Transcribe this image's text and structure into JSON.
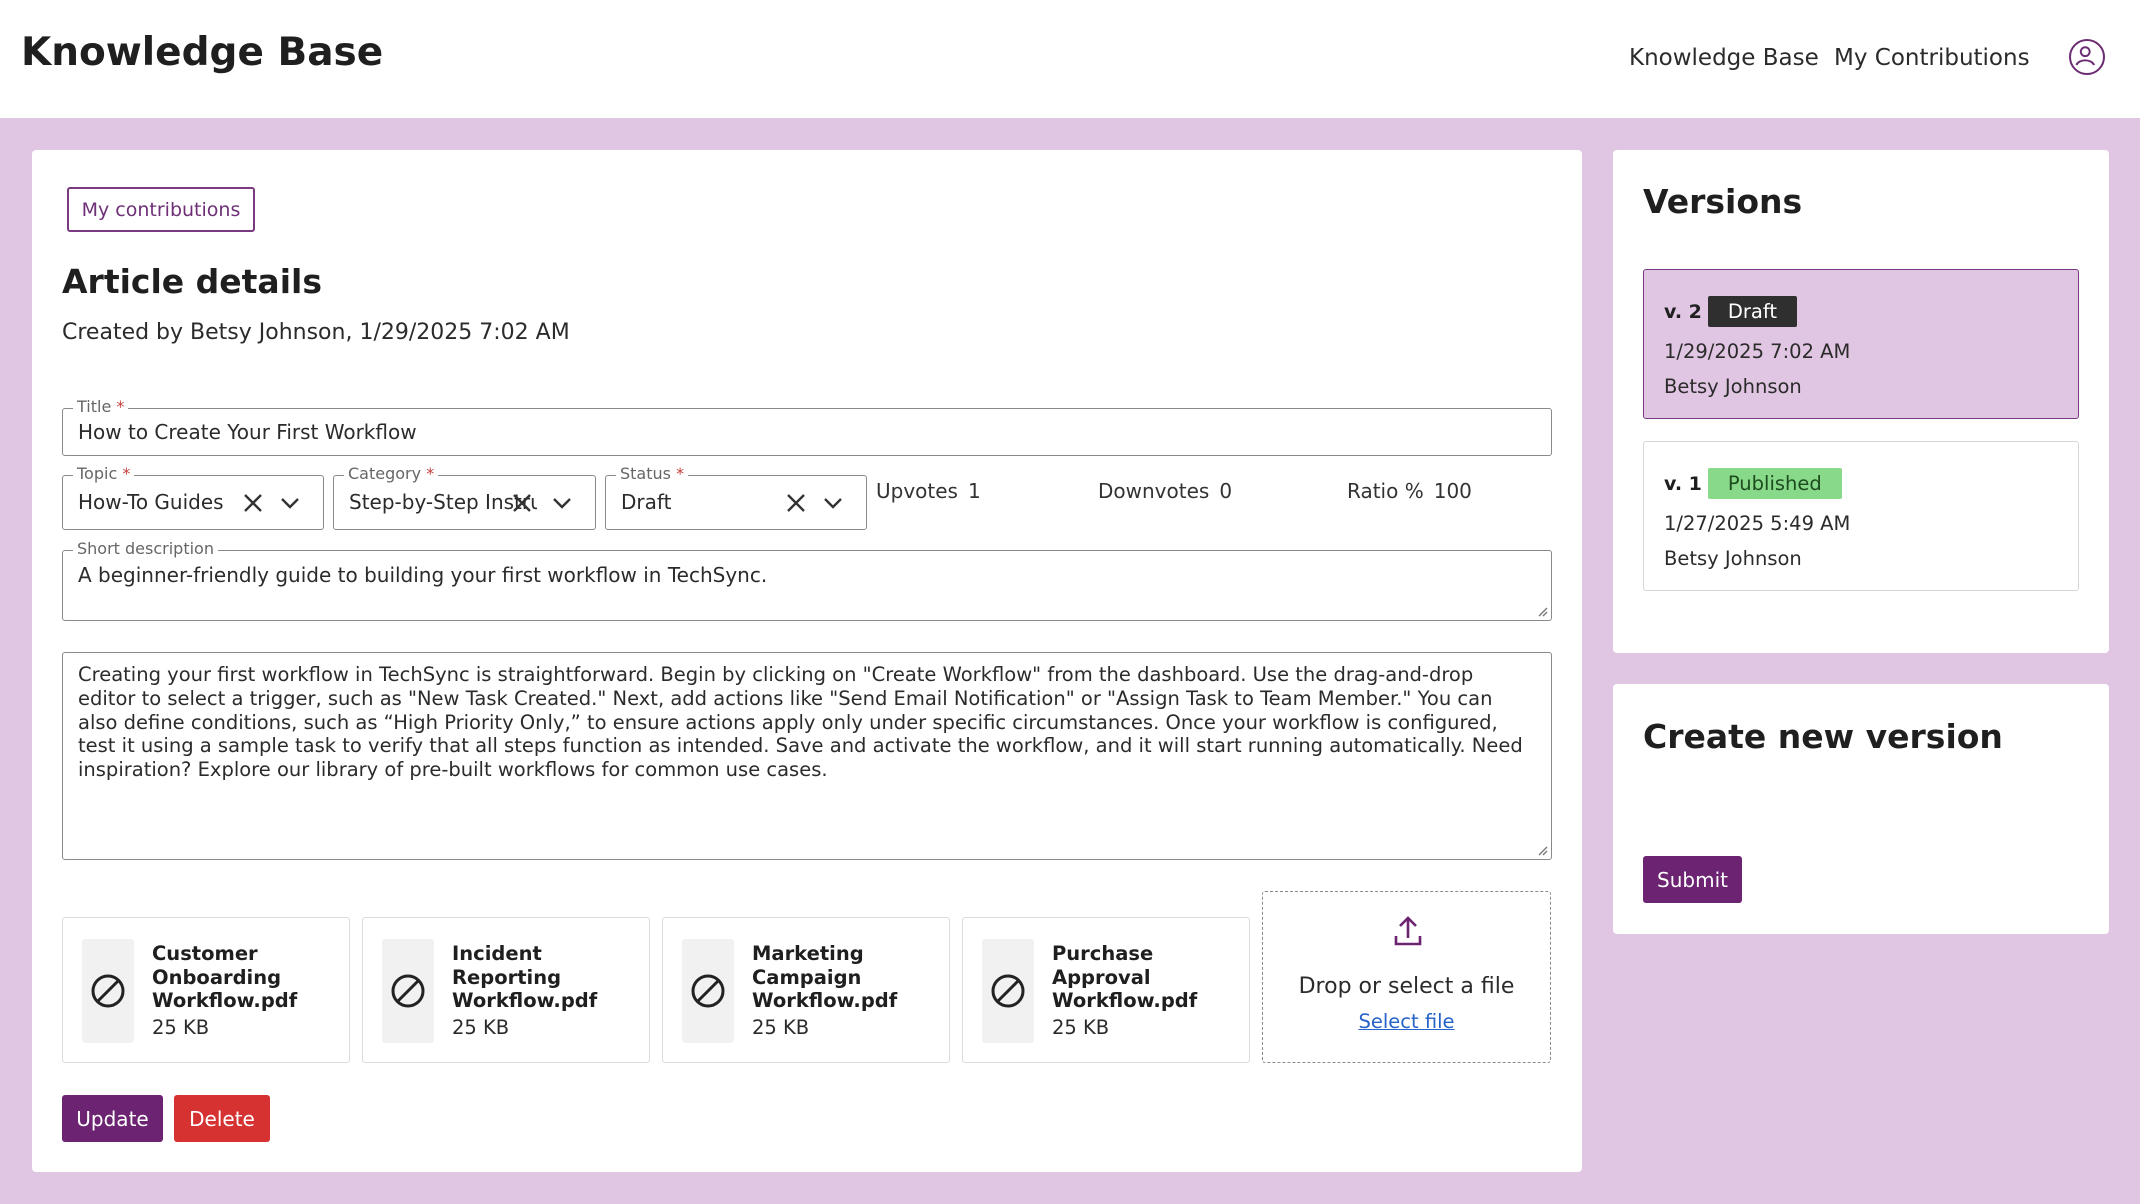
{
  "header": {
    "app_title": "Knowledge Base",
    "nav": [
      "Knowledge Base",
      "My Contributions"
    ],
    "avatar_icon": "user-circle-icon"
  },
  "main": {
    "back_button": "My contributions",
    "heading": "Article details",
    "created_by": "Created by Betsy Johnson, 1/29/2025 7:02 AM",
    "title": {
      "label": "Title",
      "required": "*",
      "value": "How to Create Your First Workflow"
    },
    "topic": {
      "label": "Topic",
      "required": "*",
      "value": "How-To Guides"
    },
    "category": {
      "label": "Category",
      "required": "*",
      "value": "Step-by-Step Instructions"
    },
    "status": {
      "label": "Status",
      "required": "*",
      "value": "Draft"
    },
    "stats": {
      "upvotes_label": "Upvotes",
      "upvotes": "1",
      "downvotes_label": "Downvotes",
      "downvotes": "0",
      "ratio_label": "Ratio %",
      "ratio": "100"
    },
    "short_description": {
      "label": "Short description",
      "value": "A beginner-friendly guide to building your first workflow in TechSync."
    },
    "body": "Creating your first workflow in TechSync is straightforward. Begin by clicking on \"Create Workflow\" from the dashboard. Use the drag-and-drop editor to select a trigger, such as \"New Task Created.\" Next, add actions like \"Send Email Notification\" or \"Assign Task to Team Member.\" You can also define conditions, such as “High Priority Only,” to ensure actions apply only under specific circumstances. Once your workflow is configured, test it using a sample task to verify that all steps function as intended. Save and activate the workflow, and it will start running automatically. Need inspiration? Explore our library of pre-built workflows for common use cases.",
    "files": [
      {
        "name": "Customer Onboarding Workflow.pdf",
        "size": "25 KB"
      },
      {
        "name": "Incident Reporting Workflow.pdf",
        "size": "25 KB"
      },
      {
        "name": "Marketing Campaign Workflow.pdf",
        "size": "25 KB"
      },
      {
        "name": "Purchase Approval Workflow.pdf",
        "size": "25 KB"
      }
    ],
    "dropzone": {
      "text": "Drop or select a file",
      "link": "Select file"
    },
    "buttons": {
      "update": "Update",
      "delete": "Delete"
    }
  },
  "versions": {
    "heading": "Versions",
    "items": [
      {
        "num": "v. 2",
        "status": "Draft",
        "date": "1/29/2025 7:02 AM",
        "author": "Betsy Johnson"
      },
      {
        "num": "v. 1",
        "status": "Published",
        "date": "1/27/2025 5:49 AM",
        "author": "Betsy Johnson"
      }
    ]
  },
  "create_version": {
    "heading": "Create new version",
    "submit": "Submit"
  },
  "colors": {
    "brand": "#6b2372",
    "background": "#e1c6e3",
    "danger": "#d63232",
    "published": "#88d98a",
    "draft": "#2f2f2f"
  }
}
